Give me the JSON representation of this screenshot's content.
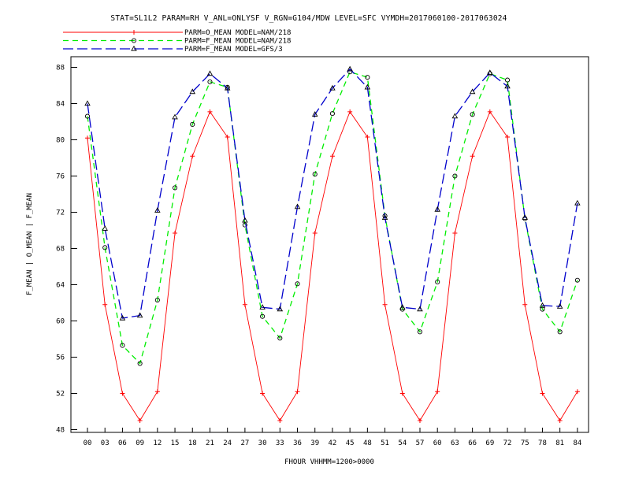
{
  "chart_data": {
    "type": "line",
    "title": "STAT=SL1L2 PARAM=RH V_ANL=ONLYSF V_RGN=G104/MDW LEVEL=SFC VYMDH=2017060100-2017063024",
    "xlabel": "FHOUR VHHMM=1200>0000",
    "ylabel": "F_MEAN | O_MEAN | F_MEAN",
    "x": [
      "00",
      "03",
      "06",
      "09",
      "12",
      "15",
      "18",
      "21",
      "24",
      "27",
      "30",
      "33",
      "36",
      "39",
      "42",
      "45",
      "48",
      "51",
      "54",
      "57",
      "60",
      "63",
      "66",
      "69",
      "72",
      "75",
      "78",
      "81",
      "84"
    ],
    "ylim": [
      47,
      90
    ],
    "yticks": [
      48,
      52,
      56,
      60,
      64,
      68,
      72,
      76,
      80,
      84,
      88
    ],
    "grid": false,
    "legend": "top-left",
    "series": [
      {
        "name": "PARM=O_MEAN MODEL=NAM/218",
        "color": "#ff0000",
        "style": "solid",
        "marker": "plus",
        "values": [
          80.2,
          61.8,
          52.0,
          49.0,
          52.2,
          69.7,
          78.2,
          83.1,
          80.3,
          61.8,
          52.0,
          49.0,
          52.2,
          69.7,
          78.2,
          83.1,
          80.3,
          61.8,
          52.0,
          49.0,
          52.2,
          69.7,
          78.2,
          83.1,
          80.3,
          61.8,
          52.0,
          49.0,
          52.2
        ]
      },
      {
        "name": "PARM=F_MEAN MODEL=NAM/218",
        "color": "#00ee00",
        "style": "dashed",
        "marker": "circle",
        "values": [
          82.6,
          68.1,
          57.3,
          55.3,
          62.3,
          74.7,
          81.7,
          86.4,
          85.8,
          70.6,
          60.5,
          58.1,
          64.1,
          76.2,
          82.9,
          87.5,
          86.9,
          71.6,
          61.3,
          58.8,
          64.3,
          76.0,
          82.8,
          87.3,
          86.6,
          71.3,
          61.3,
          58.8,
          64.5
        ]
      },
      {
        "name": "PARM=F_MEAN MODEL=GFS/3",
        "color": "#0000cc",
        "style": "longdash",
        "marker": "triangle",
        "values": [
          84.0,
          70.2,
          60.3,
          60.6,
          72.2,
          82.5,
          85.3,
          87.3,
          85.7,
          71.1,
          61.5,
          61.3,
          72.6,
          82.8,
          85.7,
          87.8,
          85.8,
          71.4,
          61.5,
          61.3,
          72.3,
          82.6,
          85.3,
          87.4,
          85.9,
          71.4,
          61.7,
          61.6,
          73.0
        ]
      }
    ]
  }
}
